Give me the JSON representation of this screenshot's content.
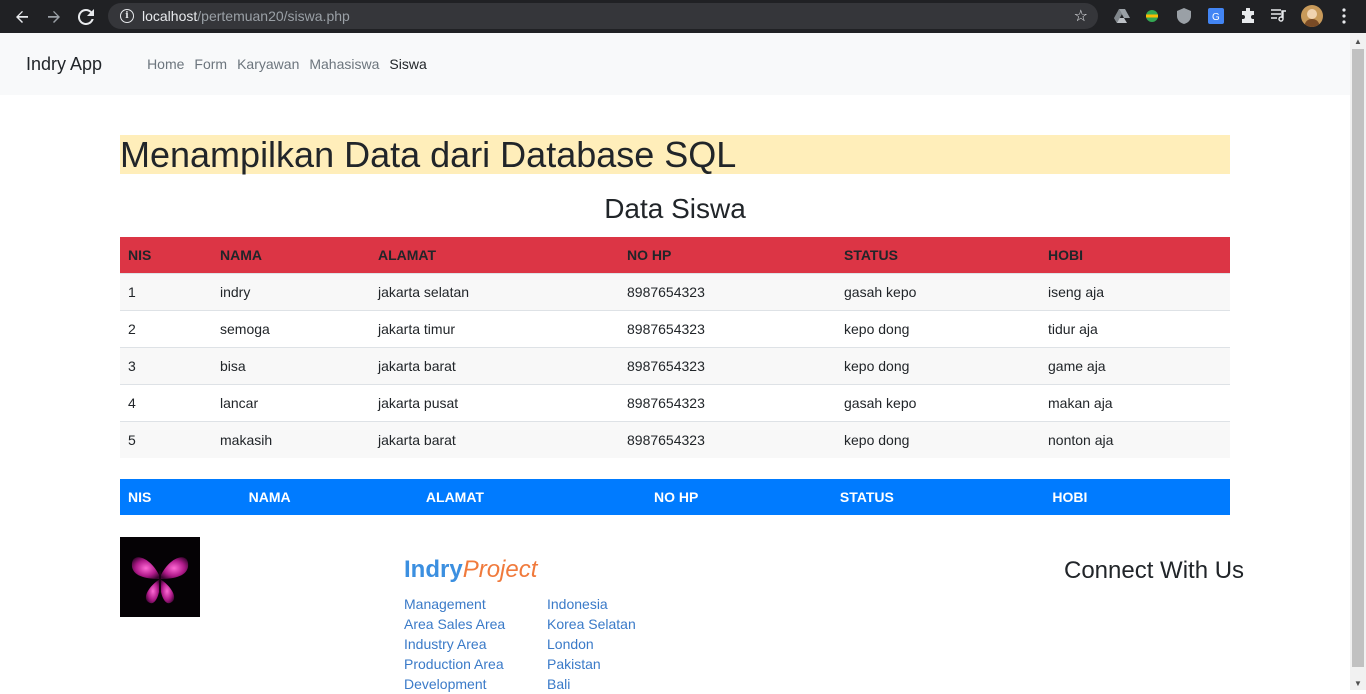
{
  "browser": {
    "url_host": "localhost",
    "url_path": "/pertemuan20/siswa.php"
  },
  "navbar": {
    "brand": "Indry App",
    "links": [
      "Home",
      "Form",
      "Karyawan",
      "Mahasiswa",
      "Siswa"
    ],
    "active": "Siswa"
  },
  "hero": {
    "title": "Menampilkan Data dari Database SQL"
  },
  "section": {
    "title": "Data Siswa"
  },
  "table": {
    "headers": [
      "NIS",
      "NAMA",
      "ALAMAT",
      "NO HP",
      "STATUS",
      "HOBI"
    ],
    "rows": [
      [
        "1",
        "indry",
        "jakarta selatan",
        "8987654323",
        "gasah kepo",
        "iseng aja"
      ],
      [
        "2",
        "semoga",
        "jakarta timur",
        "8987654323",
        "kepo dong",
        "tidur aja"
      ],
      [
        "3",
        "bisa",
        "jakarta barat",
        "8987654323",
        "kepo dong",
        "game aja"
      ],
      [
        "4",
        "lancar",
        "jakarta pusat",
        "8987654323",
        "gasah kepo",
        "makan aja"
      ],
      [
        "5",
        "makasih",
        "jakarta barat",
        "8987654323",
        "kepo dong",
        "nonton aja"
      ]
    ]
  },
  "footer_table": {
    "headers": [
      "NIS",
      "NAMA",
      "ALAMAT",
      "NO HP",
      "STATUS",
      "HOBI"
    ]
  },
  "footer": {
    "brand_part1": "Indry",
    "brand_part2": "Project",
    "col1": [
      "Management",
      "Area Sales Area",
      "Industry Area",
      "Production Area",
      "Development"
    ],
    "col2": [
      "Indonesia",
      "Korea Selatan",
      "London",
      "Pakistan",
      "Bali"
    ],
    "connect": "Connect With Us"
  },
  "colors": {
    "hero_bg": "#ffeeba",
    "table_header_bg": "#dc3545",
    "footer_table_bg": "#007bff",
    "link": "#3a7ac8",
    "brand_blue": "#3b8fe0",
    "brand_orange": "#f07a3c"
  },
  "icons": [
    "back-icon",
    "forward-icon",
    "reload-icon",
    "info-icon",
    "star-icon",
    "extension-icon",
    "menu-icon",
    "butterfly-logo"
  ]
}
